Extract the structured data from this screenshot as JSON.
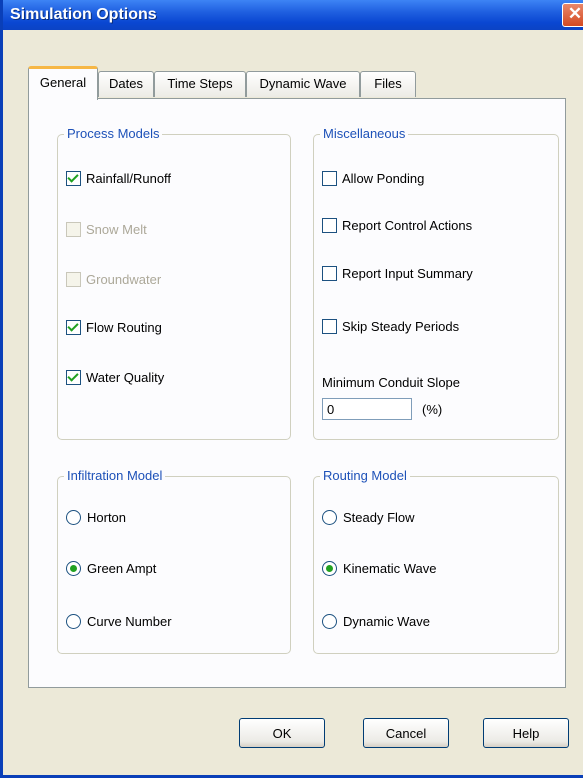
{
  "window": {
    "title": "Simulation Options",
    "close_glyph": "✕"
  },
  "tabs": [
    {
      "label": "General",
      "active": true
    },
    {
      "label": "Dates",
      "active": false
    },
    {
      "label": "Time Steps",
      "active": false
    },
    {
      "label": "Dynamic Wave",
      "active": false
    },
    {
      "label": "Files",
      "active": false
    }
  ],
  "process_models": {
    "title": "Process Models",
    "items": [
      {
        "label": "Rainfall/Runoff",
        "checked": true,
        "enabled": true
      },
      {
        "label": "Snow Melt",
        "checked": false,
        "enabled": false
      },
      {
        "label": "Groundwater",
        "checked": false,
        "enabled": false
      },
      {
        "label": "Flow Routing",
        "checked": true,
        "enabled": true
      },
      {
        "label": "Water Quality",
        "checked": true,
        "enabled": true
      }
    ]
  },
  "miscellaneous": {
    "title": "Miscellaneous",
    "items": [
      {
        "label": "Allow Ponding",
        "checked": false
      },
      {
        "label": "Report Control Actions",
        "checked": false
      },
      {
        "label": "Report Input Summary",
        "checked": false
      },
      {
        "label": "Skip Steady Periods",
        "checked": false
      }
    ],
    "min_slope_label": "Minimum Conduit Slope",
    "min_slope_value": "0",
    "min_slope_unit": "(%)"
  },
  "infiltration": {
    "title": "Infiltration Model",
    "options": [
      {
        "label": "Horton",
        "selected": false
      },
      {
        "label": "Green Ampt",
        "selected": true
      },
      {
        "label": "Curve Number",
        "selected": false
      }
    ]
  },
  "routing": {
    "title": "Routing Model",
    "options": [
      {
        "label": "Steady Flow",
        "selected": false
      },
      {
        "label": "Kinematic Wave",
        "selected": true
      },
      {
        "label": "Dynamic Wave",
        "selected": false
      }
    ]
  },
  "buttons": {
    "ok": "OK",
    "cancel": "Cancel",
    "help": "Help"
  },
  "colors": {
    "title_bar": "#0a47d2",
    "group_title": "#1d51b8",
    "check_mark": "#21a121",
    "active_tab_accent": "#f6b746"
  }
}
